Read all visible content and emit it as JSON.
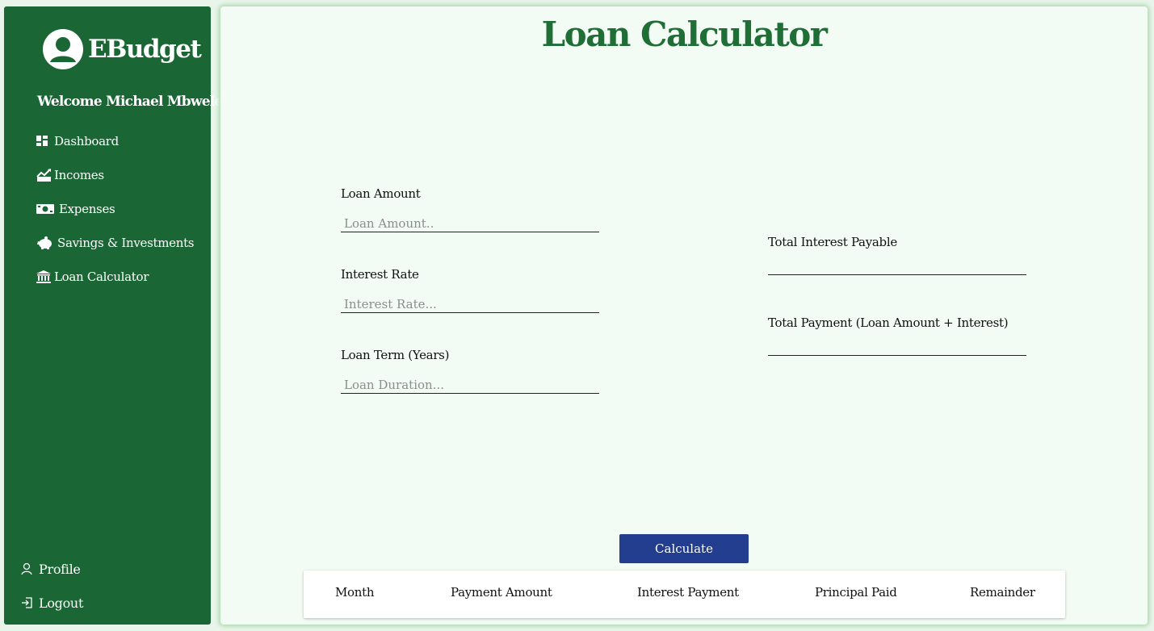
{
  "sidebar": {
    "brand": "EBudget",
    "welcome": "Welcome Michael Mbwele",
    "items": [
      {
        "label": "Dashboard",
        "icon": "dashboard-icon"
      },
      {
        "label": "Incomes",
        "icon": "chart-growth-icon"
      },
      {
        "label": "Expenses",
        "icon": "money-bill-icon"
      },
      {
        "label": "Savings & Investments",
        "icon": "piggy-bank-icon"
      },
      {
        "label": "Loan Calculator",
        "icon": "bank-icon"
      }
    ],
    "bottom_items": [
      {
        "label": "Profile",
        "icon": "user-icon"
      },
      {
        "label": "Logout",
        "icon": "logout-icon"
      }
    ]
  },
  "main": {
    "title": "Loan Calculator",
    "fields": [
      {
        "label": "Loan Amount",
        "placeholder": "Loan Amount..",
        "value": ""
      },
      {
        "label": "Interest Rate",
        "placeholder": "Interest Rate...",
        "value": ""
      },
      {
        "label": "Loan Term (Years)",
        "placeholder": "Loan Duration...",
        "value": ""
      }
    ],
    "results": [
      {
        "label": "Total Interest Payable",
        "value": ""
      },
      {
        "label": "Total Payment (Loan Amount + Interest)",
        "value": ""
      }
    ],
    "calculate_label": "Calculate",
    "table": {
      "columns": [
        "Month",
        "Payment Amount",
        "Interest Payment",
        "Principal Paid",
        "Remainder"
      ],
      "rows": []
    }
  },
  "colors": {
    "sidebar_bg": "#1a6634",
    "title_green": "#1f6e36",
    "button_blue": "#233d8f",
    "main_bg": "#f2fbf4"
  }
}
